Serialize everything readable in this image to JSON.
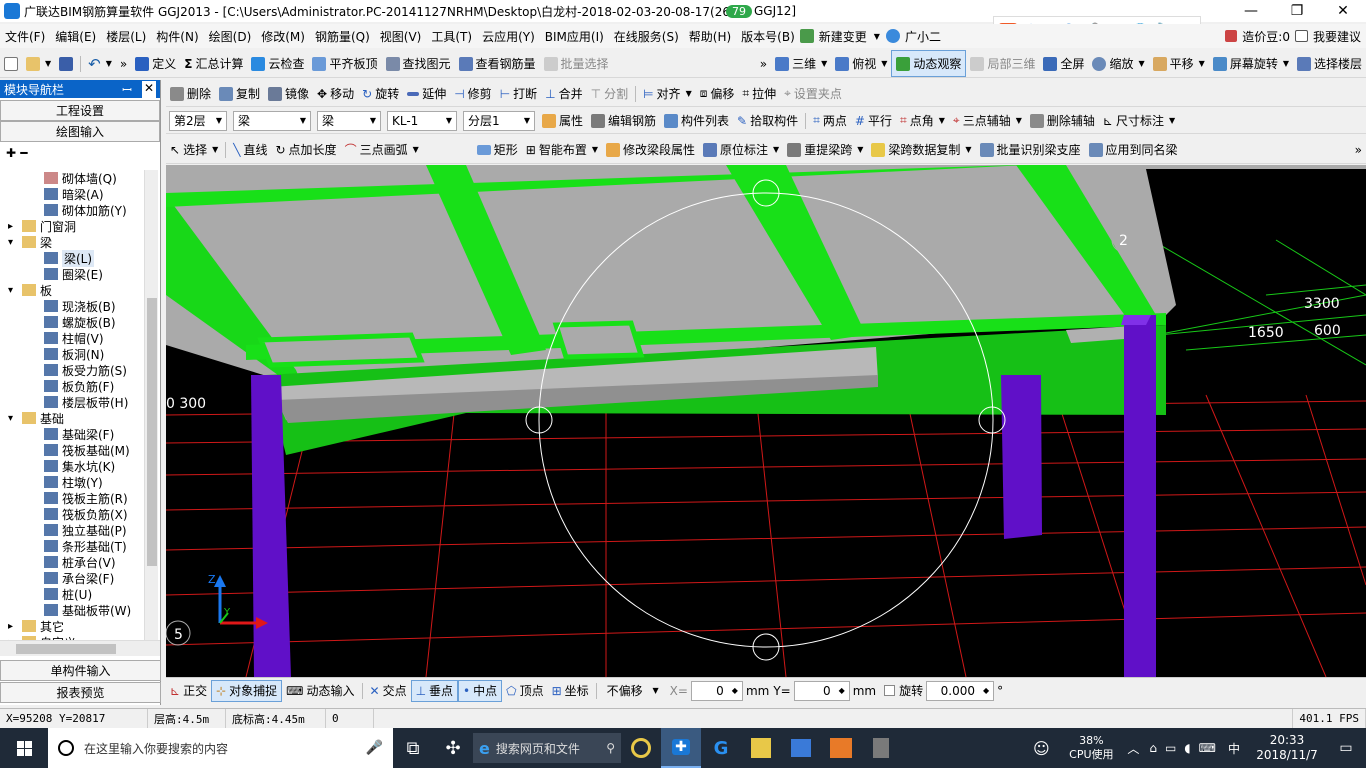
{
  "window": {
    "title": "广联达BIM钢筋算量软件 GGJ2013 - [C:\\Users\\Administrator.PC-20141127NRHM\\Desktop\\白龙村-2018-02-03-20-08-17(26",
    "title_tail": "GGJ12]",
    "badge": "79",
    "minimize": "—",
    "maximize": "❐",
    "close": "✕"
  },
  "ime": {
    "logo": "S",
    "lang": "中",
    "punct": "°,",
    "items": [
      "☺",
      "🎤",
      "⌨",
      "👕",
      "🔧"
    ]
  },
  "menu": [
    "文件(F)",
    "编辑(E)",
    "楼层(L)",
    "构件(N)",
    "绘图(D)",
    "修改(M)",
    "钢筋量(Q)",
    "视图(V)",
    "工具(T)",
    "云应用(Y)",
    "BIM应用(I)",
    "在线服务(S)",
    "帮助(H)",
    "版本号(B)",
    "新建变更",
    "广小二"
  ],
  "menu_right": {
    "coins": "造价豆:0",
    "suggest": "我要建议"
  },
  "toolbar1": {
    "items": [
      "定义",
      "汇总计算",
      "云检查",
      "平齐板顶",
      "查找图元",
      "查看钢筋量",
      "批量选择"
    ],
    "view": [
      "三维",
      "俯视",
      "动态观察",
      "局部三维",
      "全屏",
      "缩放",
      "平移",
      "屏幕旋转",
      "选择楼层"
    ]
  },
  "panel": {
    "title": "模块导航栏",
    "pin": "ꟷ",
    "close": "✕",
    "btn_project": "工程设置",
    "btn_draw": "绘图输入",
    "btn_single": "单构件输入",
    "btn_report": "报表预览",
    "tools": "✚ ━"
  },
  "tree": [
    {
      "lvl": 2,
      "label": "砌体墙(Q)",
      "ic": "#c88"
    },
    {
      "lvl": 2,
      "label": "暗梁(A)",
      "ic": "#57a"
    },
    {
      "lvl": 2,
      "label": "砌体加筋(Y)",
      "ic": "#57a"
    },
    {
      "lvl": 1,
      "label": "门窗洞",
      "ic": "#e8c36a",
      "toggle": "▸"
    },
    {
      "lvl": 1,
      "label": "梁",
      "ic": "#e8c36a",
      "toggle": "▾"
    },
    {
      "lvl": 2,
      "label": "梁(L)",
      "ic": "#57a",
      "sel": true
    },
    {
      "lvl": 2,
      "label": "圈梁(E)",
      "ic": "#57a"
    },
    {
      "lvl": 1,
      "label": "板",
      "ic": "#e8c36a",
      "toggle": "▾"
    },
    {
      "lvl": 2,
      "label": "现浇板(B)",
      "ic": "#57a"
    },
    {
      "lvl": 2,
      "label": "螺旋板(B)",
      "ic": "#57a"
    },
    {
      "lvl": 2,
      "label": "柱帽(V)",
      "ic": "#57a"
    },
    {
      "lvl": 2,
      "label": "板洞(N)",
      "ic": "#57a"
    },
    {
      "lvl": 2,
      "label": "板受力筋(S)",
      "ic": "#57a"
    },
    {
      "lvl": 2,
      "label": "板负筋(F)",
      "ic": "#57a"
    },
    {
      "lvl": 2,
      "label": "楼层板带(H)",
      "ic": "#57a"
    },
    {
      "lvl": 1,
      "label": "基础",
      "ic": "#e8c36a",
      "toggle": "▾"
    },
    {
      "lvl": 2,
      "label": "基础梁(F)",
      "ic": "#57a"
    },
    {
      "lvl": 2,
      "label": "筏板基础(M)",
      "ic": "#57a"
    },
    {
      "lvl": 2,
      "label": "集水坑(K)",
      "ic": "#57a"
    },
    {
      "lvl": 2,
      "label": "柱墩(Y)",
      "ic": "#57a"
    },
    {
      "lvl": 2,
      "label": "筏板主筋(R)",
      "ic": "#57a"
    },
    {
      "lvl": 2,
      "label": "筏板负筋(X)",
      "ic": "#57a"
    },
    {
      "lvl": 2,
      "label": "独立基础(P)",
      "ic": "#57a"
    },
    {
      "lvl": 2,
      "label": "条形基础(T)",
      "ic": "#57a"
    },
    {
      "lvl": 2,
      "label": "桩承台(V)",
      "ic": "#57a"
    },
    {
      "lvl": 2,
      "label": "承台梁(F)",
      "ic": "#57a"
    },
    {
      "lvl": 2,
      "label": "桩(U)",
      "ic": "#57a"
    },
    {
      "lvl": 2,
      "label": "基础板带(W)",
      "ic": "#57a"
    },
    {
      "lvl": 1,
      "label": "其它",
      "ic": "#e8c36a",
      "toggle": "▸"
    },
    {
      "lvl": 1,
      "label": "自定义",
      "ic": "#e8c36a",
      "toggle": "▸"
    }
  ],
  "toolbar2": [
    "删除",
    "复制",
    "镜像",
    "移动",
    "旋转",
    "延伸",
    "修剪",
    "打断",
    "合并",
    "分割",
    "对齐",
    "偏移",
    "拉伸",
    "设置夹点"
  ],
  "toolbar3": {
    "floor": "第2层",
    "cat1": "梁",
    "cat2": "梁",
    "name": "KL-1",
    "layer": "分层1",
    "items": [
      "属性",
      "编辑钢筋",
      "构件列表",
      "拾取构件",
      "两点",
      "平行",
      "点角",
      "三点辅轴",
      "删除辅轴",
      "尺寸标注"
    ]
  },
  "toolbar4": [
    "选择",
    "直线",
    "点加长度",
    "三点画弧",
    "矩形",
    "智能布置",
    "修改梁段属性",
    "原位标注",
    "重提梁跨",
    "梁跨数据复制",
    "批量识别梁支座",
    "应用到同名梁"
  ],
  "viewport": {
    "labels": [
      "2",
      "3300",
      "1650",
      "600",
      "0 300",
      "5"
    ],
    "axis_z": "Z",
    "axis_y": "Y"
  },
  "snapbar": {
    "items": [
      "正交",
      "对象捕捉",
      "动态输入",
      "交点",
      "垂点",
      "中点",
      "顶点",
      "坐标"
    ],
    "offset": "不偏移",
    "x_label": "X=",
    "x_val": "0",
    "y_label": "Y=",
    "y_val": "0",
    "unit": "mm",
    "rotate": "旋转",
    "rot_val": "0.000",
    "deg": "°"
  },
  "status": {
    "coords": "X=95208 Y=20817",
    "floor_h": "层高:4.5m",
    "base_h": "底标高:4.45m",
    "zero": "0",
    "fps": "401.1 FPS"
  },
  "taskbar": {
    "search": "在这里输入你要搜索的内容",
    "web_search": "搜索网页和文件",
    "cpu_pct": "38%",
    "cpu_label": "CPU使用",
    "ime": "中",
    "time": "20:33",
    "date": "2018/11/7"
  }
}
